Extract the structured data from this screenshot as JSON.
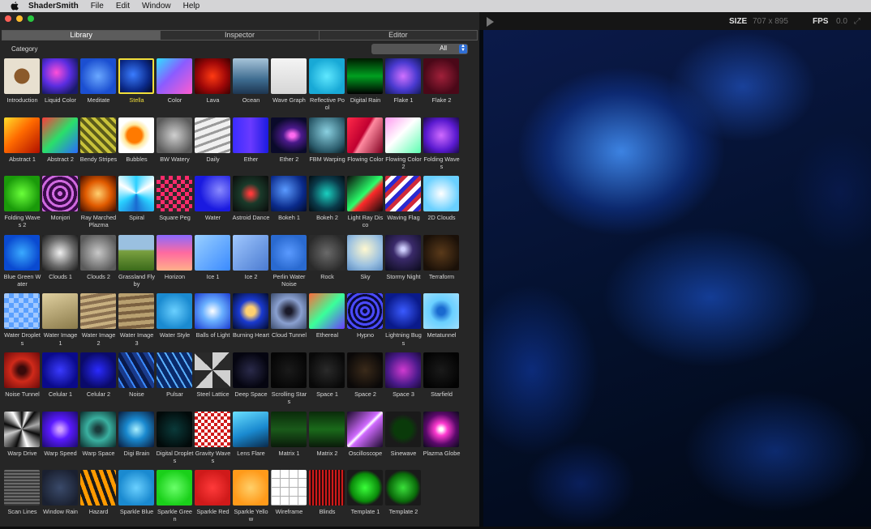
{
  "menubar": {
    "app": "ShaderSmith",
    "items": [
      "File",
      "Edit",
      "Window",
      "Help"
    ]
  },
  "library": {
    "tabs": [
      "Library",
      "Inspector",
      "Editor"
    ],
    "active_tab": "Library",
    "category_label": "Category",
    "category_value": "All",
    "selected": "Stella",
    "shaders": [
      {
        "name": "Introductio​n",
        "bg": "radial-gradient(circle at 50% 50%,#8b5a2b 0 30%,#e8e0d0 31% 100%)"
      },
      {
        "name": "Liquid Color",
        "bg": "radial-gradient(circle at 40% 40%,#ff4fd8,#5a2de0 45%,#1a1a6a 80%)"
      },
      {
        "name": "Meditate",
        "bg": "radial-gradient(circle at 50% 50%,#6aa8ff,#1b4fd1 70%)"
      },
      {
        "name": "Stella",
        "bg": "radial-gradient(circle at 40% 45%,#3a7cff,#0b2a8a 60%,#02061e)"
      },
      {
        "name": "Color",
        "bg": "linear-gradient(135deg,#2ee0ff,#8a5cff 45%,#ff5ccf)"
      },
      {
        "name": "Lava",
        "bg": "radial-gradient(circle at 50% 50%,#ff3a12,#a00808 55%,#3a0000)"
      },
      {
        "name": "Ocean",
        "bg": "linear-gradient(180deg,#a7c4d9,#3d6b8f 60%,#1d3550)"
      },
      {
        "name": "Wave Grap​h",
        "bg": "linear-gradient(180deg,#f4f4f4,#d6d6d6)"
      },
      {
        "name": "Reflective Pool",
        "bg": "radial-gradient(circle at 50% 50%,#5fe8ff,#18a9d6 70%)"
      },
      {
        "name": "Digital Rain",
        "bg": "linear-gradient(180deg,#001a00,#00a020 50%,#000)"
      },
      {
        "name": "Flake 1",
        "bg": "radial-gradient(circle at 50% 50%,#d070ff,#4a3ad0 55%,#121a5a)"
      },
      {
        "name": "Flake 2",
        "bg": "radial-gradient(circle at 50% 50%,#a0203a,#4a0818 70%)"
      },
      {
        "name": "Abstract 1",
        "bg": "linear-gradient(135deg,#ffde2a,#ff6a00 45%,#b01000)"
      },
      {
        "name": "Abstract 2",
        "bg": "linear-gradient(135deg,#ff3a3a,#2adf6a 50%,#2a6aff)"
      },
      {
        "name": "Bendy Strip​es",
        "bg": "repeating-linear-gradient(45deg,#c8c23a 0 4px,#5a5a1a 4px 8px)"
      },
      {
        "name": "Bubbles",
        "bg": "radial-gradient(circle at 45% 50%,#ff7a00 0 28%,#ffe89a 40%,#fff 60%)"
      },
      {
        "name": "BW Watery",
        "bg": "radial-gradient(circle at 50% 50%,#d0d0d0,#5a5a5a 80%)"
      },
      {
        "name": "Daily",
        "bg": "repeating-linear-gradient(160deg,#f0f0f0 0 6px,#9a9a9a 6px 9px)"
      },
      {
        "name": "Ether",
        "bg": "linear-gradient(90deg,#3a2cff,#6a3aff 50%,#1a1ae0)"
      },
      {
        "name": "Ether 2",
        "bg": "radial-gradient(ellipse at 60% 50%,#ff6af0 0 8%,#4a1a8a 30%,#0a0a2a 70%)"
      },
      {
        "name": "FBM Warpi​ng",
        "bg": "radial-gradient(circle at 50% 40%,#8ad0e0,#2a5a6a 70%,#0a1a20)"
      },
      {
        "name": "Flowing Col​or",
        "bg": "linear-gradient(120deg,#ff2a4a,#c00030 45%,#ff8aa0 52%,#800020)"
      },
      {
        "name": "Flowing Col​or 2",
        "bg": "linear-gradient(135deg,#ff9af0,#fff 45%,#5affb0)"
      },
      {
        "name": "Folding Wa​ves",
        "bg": "radial-gradient(circle at 50% 50%,#d06aff,#5a1ad0 60%,#1a0a4a)"
      },
      {
        "name": "Folding Wa​ves 2",
        "bg": "radial-gradient(circle at 50% 50%,#6aff3a,#1a9a0a 70%)"
      },
      {
        "name": "Monjori",
        "bg": "repeating-radial-gradient(ellipse at 50% 50%,#d06ae0 0 3px,#3a0a4a 3px 7px)"
      },
      {
        "name": "Ray Marche​d Plazma",
        "bg": "radial-gradient(circle at 50% 50%,#ffd070,#e05a00 50%,#3a0a00)"
      },
      {
        "name": "Spiral",
        "bg": "conic-gradient(#2ad0ff,#fff,#2ad0ff,#1a6ad0,#2ad0ff,#fff,#2ad0ff)"
      },
      {
        "name": "Square Peg",
        "bg": "repeating-conic-gradient(#ff2a6a 0 25%,#2a2a2a 0 50%) 0 0/10px 10px"
      },
      {
        "name": "Water",
        "bg": "radial-gradient(circle at 70% 40%,#8a8aff,#1a1ae0 60%)"
      },
      {
        "name": "Astroid Dan​ce",
        "bg": "radial-gradient(circle at 50% 50%,#ff3a3a 0 5%,#1a3a2a 40%,#0a0a0a)"
      },
      {
        "name": "Bokeh 1",
        "bg": "radial-gradient(circle at 40% 40%,#5a9aff,#0a2a8a 60%,#020a2a)"
      },
      {
        "name": "Bokeh 2",
        "bg": "radial-gradient(circle at 50% 50%,#1ad0c0,#0a3a4a 60%,#020a10)"
      },
      {
        "name": "Light Ray D​isco",
        "bg": "linear-gradient(135deg,#0a0a0a,#2aff6a 50%,#ff2a2a 60%,#0a0a0a)"
      },
      {
        "name": "Waving Fla​g",
        "bg": "repeating-linear-gradient(135deg,#d02a3a 0 5px,#fff 5px 10px,#2a2ad0 10px 15px)"
      },
      {
        "name": "2D Clouds",
        "bg": "radial-gradient(circle at 50% 50%,#fff,#6ad0ff 70%)"
      },
      {
        "name": "Blue Green Water",
        "bg": "radial-gradient(circle at 50% 50%,#3aaaff,#0a4ad0 70%)"
      },
      {
        "name": "Clouds 1",
        "bg": "radial-gradient(circle at 50% 50%,#f0f0f0,#6a6a6a 55%,#1a1a1a)"
      },
      {
        "name": "Clouds 2",
        "bg": "radial-gradient(circle at 50% 50%,#c8c8c8,#5a5a5a 80%)"
      },
      {
        "name": "Grassland Flyby",
        "bg": "linear-gradient(180deg,#9ac0e0 0 40%,#7aa040 45%,#3a6a1a)"
      },
      {
        "name": "Horizon",
        "bg": "linear-gradient(180deg,#8a6aff,#ff6aa0 50%,#ffb08a)"
      },
      {
        "name": "Ice 1",
        "bg": "linear-gradient(135deg,#9ad0ff,#3a8aff)"
      },
      {
        "name": "Ice 2",
        "bg": "linear-gradient(135deg,#a0c8ff,#4a7ad0)"
      },
      {
        "name": "Perlin Wate​r Noise",
        "bg": "radial-gradient(circle at 50% 50%,#5a9aff,#2a6ad0 70%)"
      },
      {
        "name": "Rock",
        "bg": "radial-gradient(circle at 50% 50%,#6a6a6a,#2a2a2a 80%)"
      },
      {
        "name": "Sky",
        "bg": "radial-gradient(circle at 50% 40%,#fff8d0,#9ac0e0 60%,#5a8ac0)"
      },
      {
        "name": "Stormy Nig​ht",
        "bg": "radial-gradient(circle at 50% 40%,#d0d0ff 0 6%,#3a2a6a 35%,#0a0a1a)"
      },
      {
        "name": "Terraform",
        "bg": "radial-gradient(circle at 50% 50%,#5a3a1a,#1a1008 80%)"
      },
      {
        "name": "Water Drop​lets",
        "bg": "repeating-conic-gradient(#5aa0ff 0 25%,#a0c8ff 0 50%) 0 0/12px 12px"
      },
      {
        "name": "Water Imag​e 1",
        "bg": "linear-gradient(160deg,#e0d0a0,#8a7a4a)"
      },
      {
        "name": "Water Imag​e 2",
        "bg": "repeating-linear-gradient(170deg,#c8b080 0 4px,#8a7050 4px 8px)"
      },
      {
        "name": "Water Imag​e 3",
        "bg": "repeating-linear-gradient(175deg,#b8a070 0 5px,#7a6040 5px 9px)"
      },
      {
        "name": "Water Style",
        "bg": "radial-gradient(circle at 50% 50%,#6ad0ff,#1a8ad0 70%)"
      },
      {
        "name": "Balls of Lig​ht",
        "bg": "radial-gradient(circle at 50% 50%,#fff,#6ab0ff 40%,#1a3ad0)"
      },
      {
        "name": "Burning He​art",
        "bg": "radial-gradient(circle at 50% 50%,#ffd070 0 18%,#1a3ad0 45%,#020a2a)"
      },
      {
        "name": "Cloud Tunn​el",
        "bg": "radial-gradient(circle at 50% 50%,#1a1a2a 0 12%,#8aa0d0 50%,#3a4a6a)"
      },
      {
        "name": "Ethereal",
        "bg": "linear-gradient(135deg,#ff6a3a,#3aff9a 50%,#6a3aff)"
      },
      {
        "name": "Hypno",
        "bg": "repeating-radial-gradient(circle at 50% 50%,#0a0a3a 0 3px,#4a4aff 3px 6px)"
      },
      {
        "name": "Lightning B​ugs",
        "bg": "radial-gradient(circle at 50% 50%,#3a5aff,#0a1a8a 70%)"
      },
      {
        "name": "Metatunnel",
        "bg": "radial-gradient(circle at 50% 50%,#1a6ad0 0 15%,#6ad0ff 45%,#a0e0ff)"
      },
      {
        "name": "Noise Tunn​el",
        "bg": "radial-gradient(circle at 50% 50%,#3a0a0a 0 15%,#d02a1a 45%,#6a0a0a)"
      },
      {
        "name": "Celular 1",
        "bg": "radial-gradient(circle at 50% 50%,#3a3aff,#0a0a8a 70%)"
      },
      {
        "name": "Celular 2",
        "bg": "radial-gradient(circle at 50% 50%,#2a2aff,#0a0a6a 70%)"
      },
      {
        "name": "Noise",
        "bg": "repeating-linear-gradient(60deg,#1a3a8a 0 5px,#3a8aff 5px 7px,#0a1a4a 7px 12px)"
      },
      {
        "name": "Pulsar",
        "bg": "repeating-linear-gradient(60deg,#0a2a6a 0 6px,#5ab0ff 6px 8px)"
      },
      {
        "name": "Steel Lattic​e",
        "bg": "repeating-conic-gradient(#d0d0d0 0 12%,#2a2a2a 0 25%)"
      },
      {
        "name": "Deep Spac​e",
        "bg": "radial-gradient(circle at 50% 50%,#2a2a4a,#050510 70%)"
      },
      {
        "name": "Scrolling St​ars",
        "bg": "radial-gradient(circle at 50% 50%,#1a1a1a,#050505 80%)"
      },
      {
        "name": "Space 1",
        "bg": "radial-gradient(circle at 50% 50%,#2a2a2a,#080808 80%)"
      },
      {
        "name": "Space 2",
        "bg": "radial-gradient(circle at 50% 50%,#3a2a1a,#0a0808 80%)"
      },
      {
        "name": "Space 3",
        "bg": "radial-gradient(circle at 50% 50%,#d03ad0,#4a1a8a 60%,#1a0a3a)"
      },
      {
        "name": "Starfield",
        "bg": "radial-gradient(circle at 50% 50%,#1a1a1a,#030303 80%)"
      },
      {
        "name": "Warp Drive",
        "bg": "conic-gradient(#0a0a0a,#fff 5%,#0a0a0a 10%,#aaa 20%,#0a0a0a 30%,#fff 45%,#0a0a0a 55%,#ccc 70%,#0a0a0a 80%,#fff 92%,#0a0a0a)"
      },
      {
        "name": "Warp Spee​d",
        "bg": "radial-gradient(circle at 50% 50%,#d0a0ff 0 8%,#5a1aff 40%,#1a0a6a)"
      },
      {
        "name": "Warp Spac​e",
        "bg": "radial-gradient(circle at 50% 50%,#1a3a3a 0 10%,#3ab0a0 45%,#0a2a2a)"
      },
      {
        "name": "Digi Brain",
        "bg": "radial-gradient(circle at 50% 50%,#aaf0ff,#1a8ad0 40%,#0a1a3a)"
      },
      {
        "name": "Digital Dro​plets",
        "bg": "radial-gradient(circle at 50% 50%,#0a3a3a,#020a0a 80%)"
      },
      {
        "name": "Gravity Wa​ves",
        "bg": "repeating-conic-gradient(#fff 0 25%,#d01a1a 0 50%) 0 30px/8px 8px"
      },
      {
        "name": "Lens Flare",
        "bg": "linear-gradient(160deg,#6ae0ff,#1a8ad0 55%,#0a2a4a)"
      },
      {
        "name": "Matrix 1",
        "bg": "linear-gradient(180deg,#0a2a0a,#1a5a1a 50%,#0a1a0a)"
      },
      {
        "name": "Matrix 2",
        "bg": "linear-gradient(180deg,#0a2a0a,#1a6a1a 50%,#0a1a0a)"
      },
      {
        "name": "Oscilloscop​e",
        "bg": "linear-gradient(135deg,#1a0a2a,#d06aff 45%,#fff 50%,#d06aff 55%,#1a0a2a)"
      },
      {
        "name": "Sinewave",
        "bg": "radial-gradient(ellipse at 50% 50%,#0a3a0a 0 35%,#1a1a1a 60%)"
      },
      {
        "name": "Plazma Glo​be",
        "bg": "radial-gradient(circle at 50% 50%,#fff 0 6%,#ff3ad0 25%,#5a0a6a 60%,#0a0a1a)"
      },
      {
        "name": "Scan Lines",
        "bg": "repeating-linear-gradient(180deg,#6a6a6a 0 2px,#3a3a3a 2px 4px)"
      },
      {
        "name": "Window Rai​n",
        "bg": "radial-gradient(circle at 50% 50%,#3a4a6a,#1a2030 80%)"
      },
      {
        "name": "Hazard",
        "bg": "repeating-linear-gradient(70deg,#ff9a00 0 5px,#1a1a1a 5px 9px)"
      },
      {
        "name": "Sparkle Blu​e",
        "bg": "radial-gradient(circle at 50% 50%,#6ad0ff,#1a8ad0 70%)"
      },
      {
        "name": "Sparkle Gre​en",
        "bg": "radial-gradient(circle at 50% 50%,#6aff6a,#1ad01a 70%)"
      },
      {
        "name": "Sparkle Re​d",
        "bg": "radial-gradient(circle at 50% 50%,#ff3a3a,#d01a1a 70%)"
      },
      {
        "name": "Sparkle Yell​ow",
        "bg": "radial-gradient(circle at 50% 50%,#ffd06a,#ff9a1a 70%)"
      },
      {
        "name": "Wireframe",
        "bg": "repeating-linear-gradient(0deg,#b0b0b0 0 1px,transparent 1px 11px),repeating-linear-gradient(90deg,#b0b0b0 0 1px,#fff 1px 11px)"
      },
      {
        "name": "Blinds",
        "bg": "repeating-linear-gradient(90deg,#d01a1a 0 2px,#2a0a0a 2px 4px)"
      },
      {
        "name": "Template 1",
        "bg": "radial-gradient(circle at 50% 50%,#3aff3a,#0a8a0a 55%,#1a1a1a 70%)"
      },
      {
        "name": "Template 2",
        "bg": "radial-gradient(circle at 50% 50%,#3ae03a,#0a6a0a 55%,#1a1a1a 70%)"
      }
    ]
  },
  "preview": {
    "size_label": "SIZE",
    "size_value": "707 x 895",
    "fps_label": "FPS",
    "fps_value": "0.0"
  },
  "colors": {
    "accent_selected": "#f2df3a",
    "select_blue": "#2f6fd6"
  }
}
